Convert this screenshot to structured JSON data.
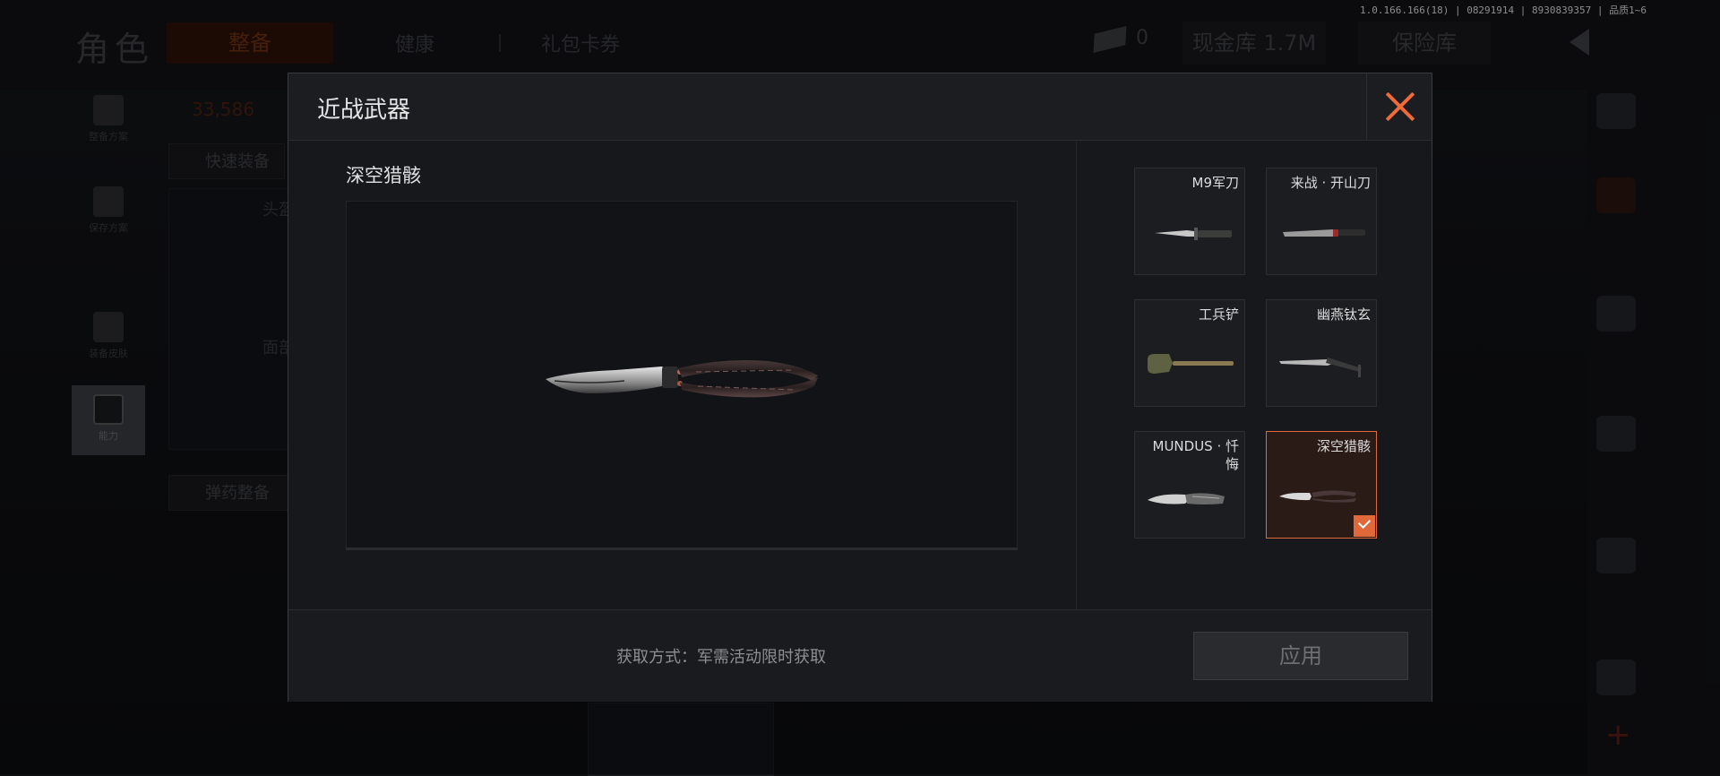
{
  "background": {
    "page_title": "角色",
    "tabs": [
      {
        "label": "整备",
        "active": true
      },
      {
        "label": "健康",
        "active": false
      },
      {
        "label": "礼包卡券",
        "active": false
      }
    ],
    "cash_count": "0",
    "cash_vault": "现金库 1.7M",
    "insurance": "保险库",
    "version_info": "1.0.166.166(18) | 08291914 | 8930839357 | 品质1~6",
    "value_display": "33,586",
    "sidebar": [
      {
        "label": "整备方案",
        "icon": "vest-icon"
      },
      {
        "label": "保存方案",
        "icon": "download-icon"
      },
      {
        "label": "装备皮肤",
        "icon": "operator-icon"
      },
      {
        "label": "能力",
        "icon": "hexagon-bolt-icon"
      }
    ],
    "quick_equip": "快速装备",
    "ammo_equip": "弹药整备",
    "head_slot": "头盔",
    "face_slot": "面部"
  },
  "modal": {
    "title": "近战武器",
    "preview_name": "深空猎骸",
    "weapons": [
      {
        "name": "M9军刀",
        "icon": "bayonet-icon",
        "selected": false
      },
      {
        "name": "来战 · 开山刀",
        "icon": "machete-icon",
        "selected": false
      },
      {
        "name": "工兵铲",
        "icon": "shovel-icon",
        "selected": false
      },
      {
        "name": "幽燕钛玄",
        "icon": "blade-icon",
        "selected": false
      },
      {
        "name": "MUNDUS · 忏悔",
        "icon": "karambit-icon",
        "selected": false
      },
      {
        "name": "深空猎骸",
        "icon": "butterfly-knife-icon",
        "selected": true
      }
    ],
    "source_text": "获取方式：军需活动限时获取",
    "apply_label": "应用"
  },
  "colors": {
    "accent": "#e0683a",
    "close": "#f06a3a",
    "panel": "#17181c"
  }
}
